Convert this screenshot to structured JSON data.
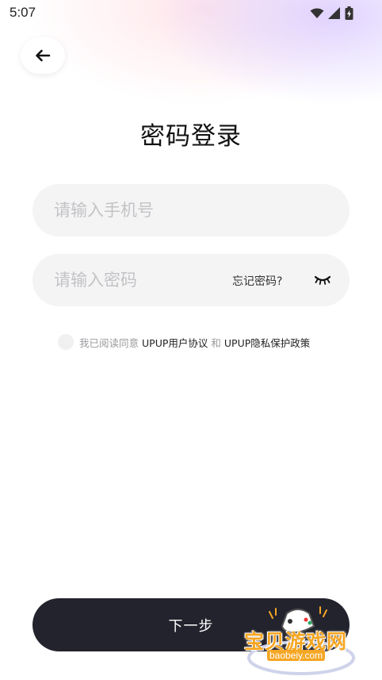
{
  "status_bar": {
    "time": "5:07",
    "icons": [
      "wifi-icon",
      "signal-icon",
      "battery-charging-icon"
    ]
  },
  "header": {
    "back_icon": "arrow-left-icon",
    "title": "密码登录"
  },
  "form": {
    "phone": {
      "value": "",
      "placeholder": "请输入手机号"
    },
    "password": {
      "value": "",
      "placeholder": "请输入密码",
      "forgot_label": "忘记密码?",
      "toggle_icon": "eye-closed-icon"
    }
  },
  "agreement": {
    "checked": false,
    "prefix": "我已阅读同意",
    "user_agreement": "UPUP用户协议",
    "conjunction": "和",
    "privacy_policy": "UPUP隐私保护政策"
  },
  "actions": {
    "next_label": "下一步"
  },
  "watermark": {
    "title": "宝贝游戏网",
    "url": "baobeiy.com"
  },
  "colors": {
    "primary_button": "#23232d",
    "field_background": "#f4f4f5",
    "placeholder": "#c3c3c6",
    "watermark_accent": "#f5a623"
  }
}
